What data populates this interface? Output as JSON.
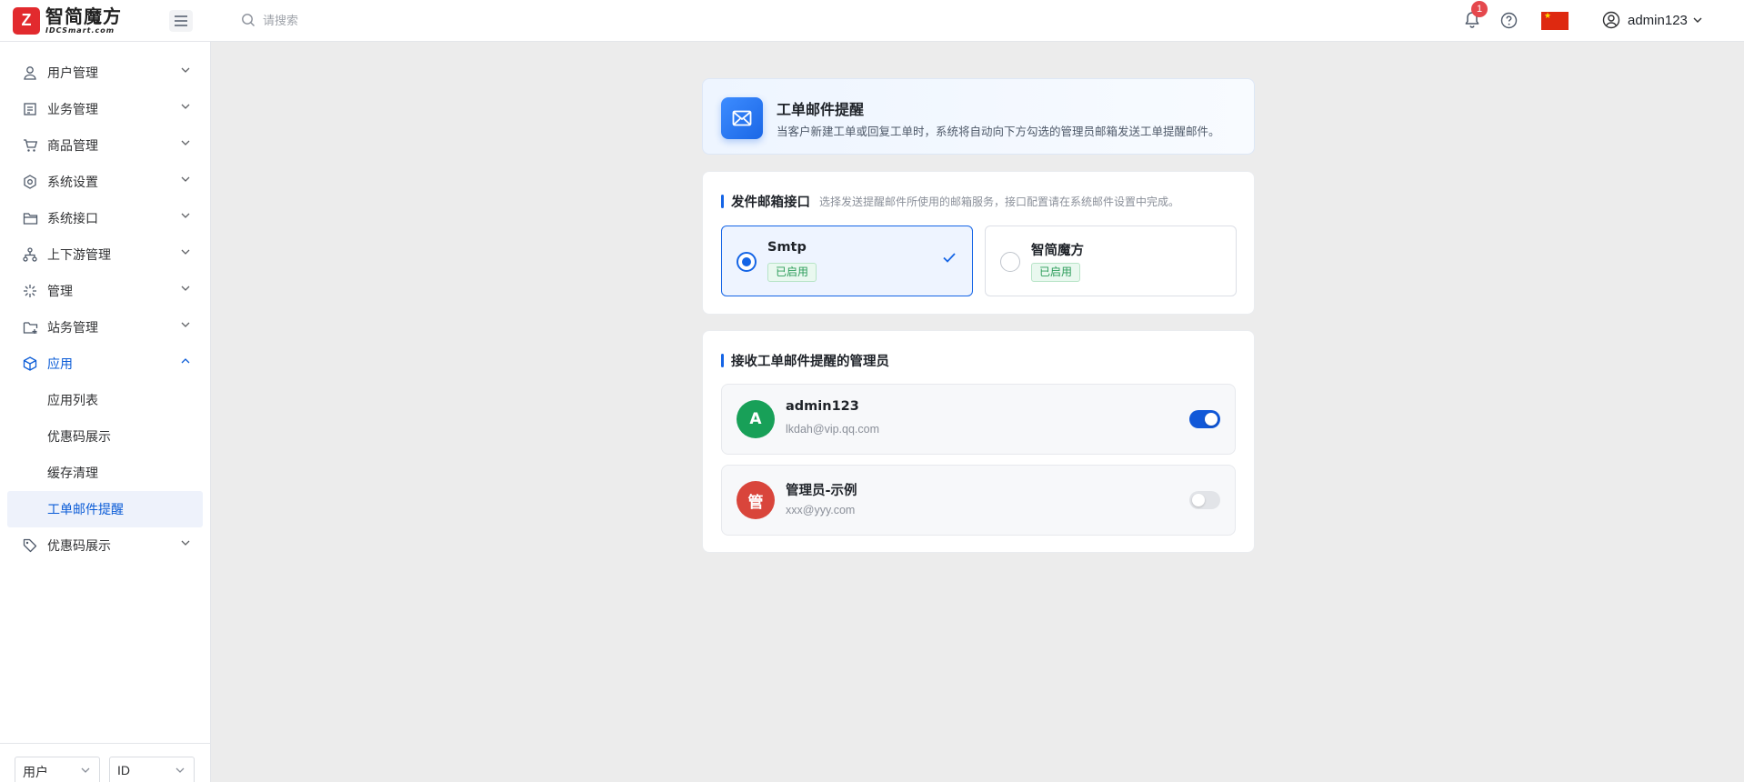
{
  "brand": {
    "mark": "Z",
    "name_cn": "智简魔方",
    "name_en": "IDCSmart.com"
  },
  "header": {
    "search_placeholder": "请搜索",
    "notification_count": "1",
    "user_name": "admin123",
    "language_flag": "china-flag-icon"
  },
  "sidebar": {
    "items": [
      {
        "label": "用户管理",
        "icon": "user-icon"
      },
      {
        "label": "业务管理",
        "icon": "document-icon"
      },
      {
        "label": "商品管理",
        "icon": "cart-icon"
      },
      {
        "label": "系统设置",
        "icon": "hexagon-gear-icon"
      },
      {
        "label": "系统接口",
        "icon": "folder-icon"
      },
      {
        "label": "上下游管理",
        "icon": "hierarchy-icon"
      },
      {
        "label": "管理",
        "icon": "burst-icon"
      },
      {
        "label": "站务管理",
        "icon": "folder-add-icon"
      },
      {
        "label": "应用",
        "icon": "cube-icon"
      }
    ],
    "app_sub_items": [
      {
        "label": "应用列表"
      },
      {
        "label": "优惠码展示"
      },
      {
        "label": "缓存清理"
      },
      {
        "label": "工单邮件提醒"
      }
    ],
    "last_item": {
      "label": "优惠码展示",
      "icon": "tag-icon"
    },
    "footer": {
      "select_type": "用户",
      "select_field": "ID"
    }
  },
  "page": {
    "title": "工单邮件提醒",
    "description": "当客户新建工单或回复工单时，系统将自动向下方勾选的管理员邮箱发送工单提醒邮件。"
  },
  "mail_interface": {
    "title": "发件邮箱接口",
    "hint": "选择发送提醒邮件所使用的邮箱服务，接口配置请在系统邮件设置中完成。",
    "options": [
      {
        "name": "Smtp",
        "status": "已启用",
        "selected": true
      },
      {
        "name": "智简魔方",
        "status": "已启用",
        "selected": false
      }
    ]
  },
  "admins": {
    "title": "接收工单邮件提醒的管理员",
    "list": [
      {
        "initial": "A",
        "name": "admin123",
        "email": "lkdah@vip.qq.com",
        "enabled": true,
        "avatar_color": "#18a058"
      },
      {
        "initial": "管",
        "name": "管理员-示例",
        "email": "xxx@yyy.com",
        "enabled": false,
        "avatar_color": "#d9453b"
      }
    ]
  },
  "colors": {
    "primary": "#1565e6",
    "success": "#2c9c5a",
    "brand_red": "#e22a2e"
  }
}
